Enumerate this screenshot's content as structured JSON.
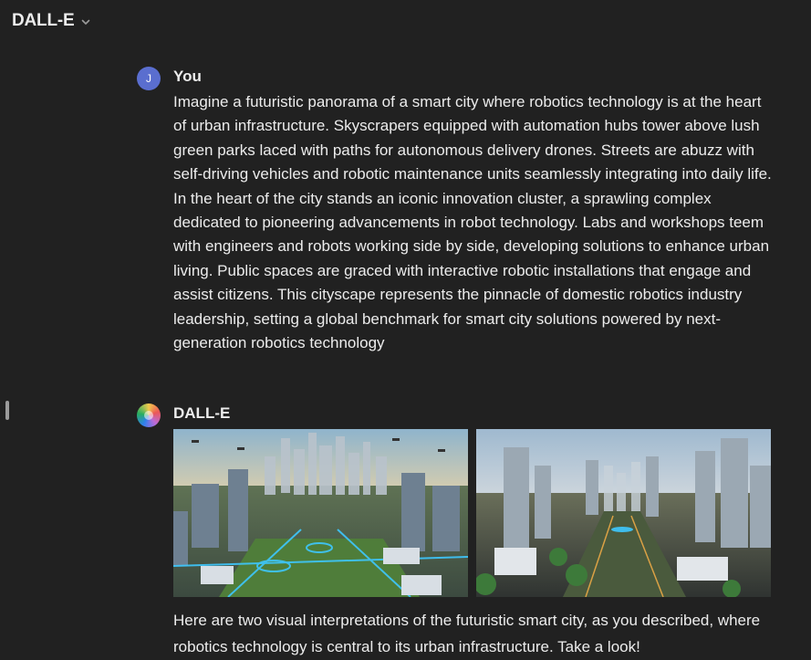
{
  "header": {
    "model_name": "DALL-E",
    "chevron_icon": "chevron-down-icon"
  },
  "conversation": {
    "user_message": {
      "avatar_letter": "J",
      "avatar_color": "#5a6ecf",
      "sender": "You",
      "text": "Imagine a futuristic panorama of a smart city where robotics technology is at the heart of urban infrastructure. Skyscrapers equipped with automation hubs tower above lush green parks laced with paths for autonomous delivery drones. Streets are abuzz with self-driving vehicles and robotic maintenance units seamlessly integrating into daily life. In the heart of the city stands an iconic innovation cluster, a sprawling complex dedicated to pioneering advancements in robot technology. Labs and workshops teem with engineers and robots working side by side, developing solutions to enhance urban living. Public spaces are graced with interactive robotic installations that engage and assist citizens. This cityscape represents the pinnacle of domestic robotics industry leadership, setting a global benchmark for smart city solutions powered by next-generation robotics technology"
    },
    "assistant_message": {
      "avatar_icon": "dalle-logo-icon",
      "sender": "DALL-E",
      "images": [
        {
          "id": "image-1",
          "description_icon": "generated-city-image-1"
        },
        {
          "id": "image-2",
          "description_icon": "generated-city-image-2"
        }
      ],
      "text": "Here are two visual interpretations of the futuristic smart city, as you described, where robotics technology is central to its urban infrastructure. Take a look!"
    }
  },
  "colors": {
    "background": "#212121",
    "text": "#ececec",
    "accent_glow": "#3ec8ff"
  }
}
